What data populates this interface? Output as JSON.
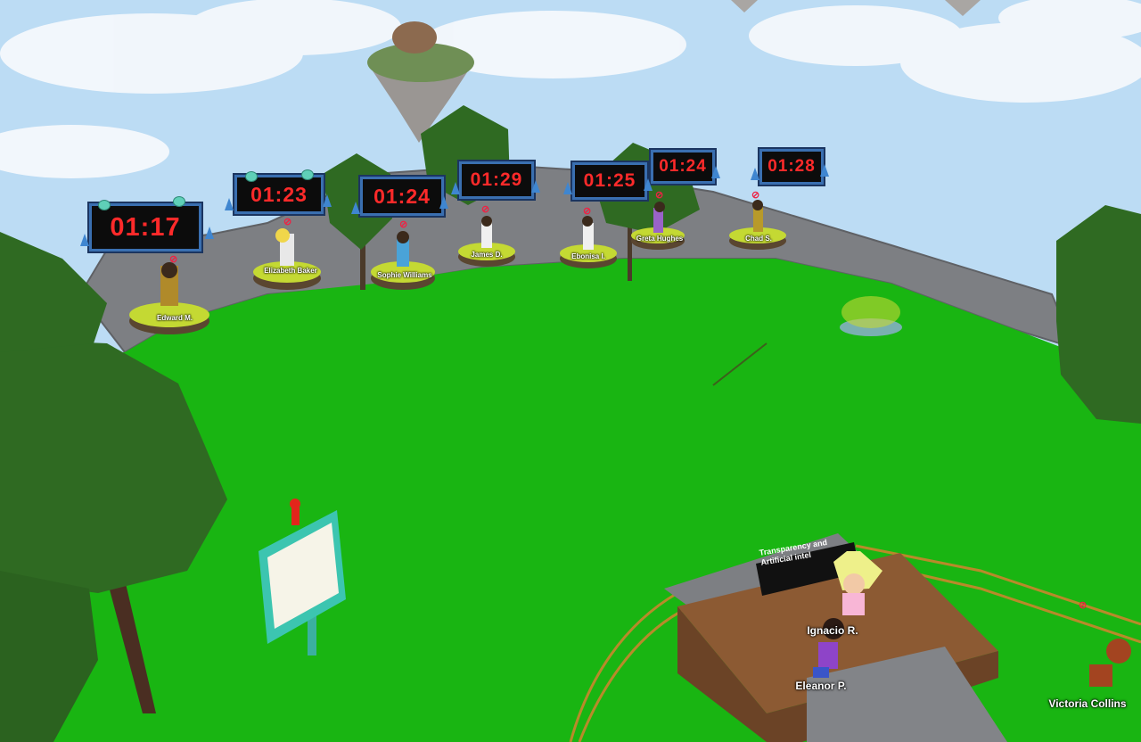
{
  "scene": {
    "type": "3D virtual event island",
    "colors": {
      "sky": "#bcdcf4",
      "grass": "#19b512",
      "rock": "#7d7f83",
      "timer_text": "#ff2a2a",
      "timer_frame": "#3a6fb0"
    }
  },
  "booths": [
    {
      "timer": "01:17",
      "name": "Edward M."
    },
    {
      "timer": "01:23",
      "name": "Elizabeth Baker"
    },
    {
      "timer": "01:24",
      "name": "Sophie Williams"
    },
    {
      "timer": "01:29",
      "name": "James D."
    },
    {
      "timer": "01:25",
      "name": "Ebonisa I."
    },
    {
      "timer": "01:24",
      "name": "Greta Hughes"
    },
    {
      "timer": "01:28",
      "name": "Chad S."
    }
  ],
  "stage": {
    "sign_line1": "Transparency and",
    "sign_line2": "Artificial intel"
  },
  "avatars": {
    "ignacio": "Ignacio R.",
    "eleanor": "Eleanor P.",
    "victoria": "Victoria Collins"
  },
  "icons": {
    "mute": "muted-microphone-icon",
    "info_board": "notice-board-icon"
  }
}
